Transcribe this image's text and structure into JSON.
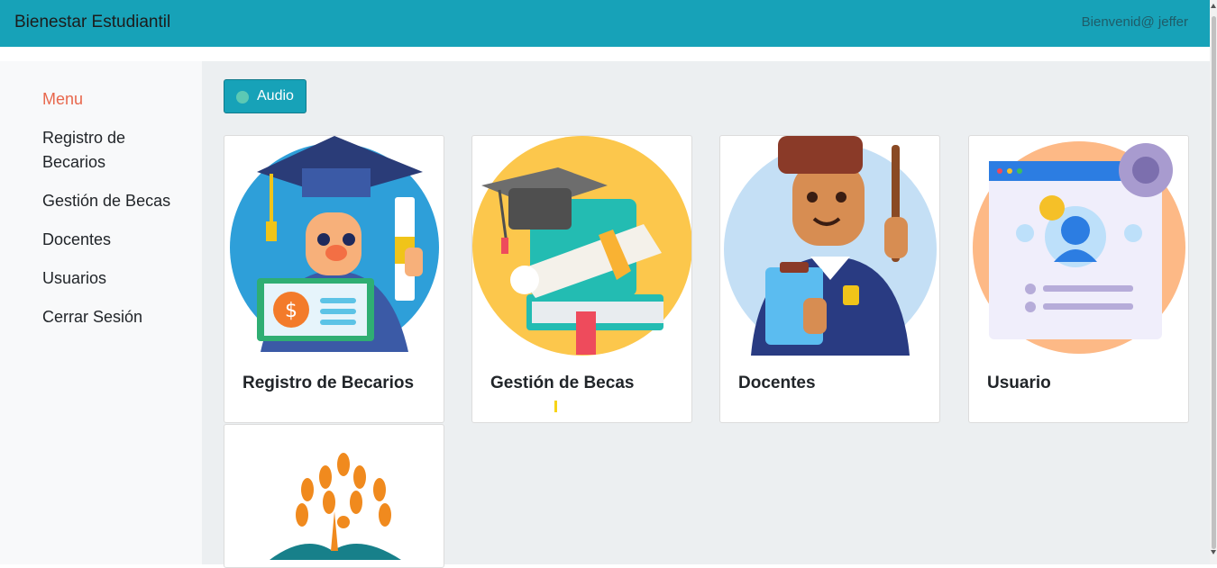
{
  "header": {
    "brand": "Bienestar Estudiantil",
    "welcome": "Bienvenid@ jeffer"
  },
  "sidebar": {
    "title": "Menu",
    "items": [
      {
        "label": "Registro de Becarios"
      },
      {
        "label": "Gestión de Becas"
      },
      {
        "label": "Docentes"
      },
      {
        "label": "Usuarios"
      },
      {
        "label": "Cerrar Sesión"
      }
    ]
  },
  "main": {
    "audio_label": "Audio",
    "cards": [
      {
        "title": "Registro de Becarios",
        "icon": "graduate-student-icon"
      },
      {
        "title": "Gestión de Becas",
        "icon": "scholarship-books-icon"
      },
      {
        "title": "Docentes",
        "icon": "teacher-icon"
      },
      {
        "title": "Usuario",
        "icon": "user-profile-icon"
      },
      {
        "title": "",
        "icon": "tree-book-logo-icon"
      }
    ]
  },
  "colors": {
    "navbar": "#17a2b8",
    "menu_title": "#e8674c",
    "main_bg": "#eceff1",
    "sidebar_bg": "#f8f9fa"
  }
}
